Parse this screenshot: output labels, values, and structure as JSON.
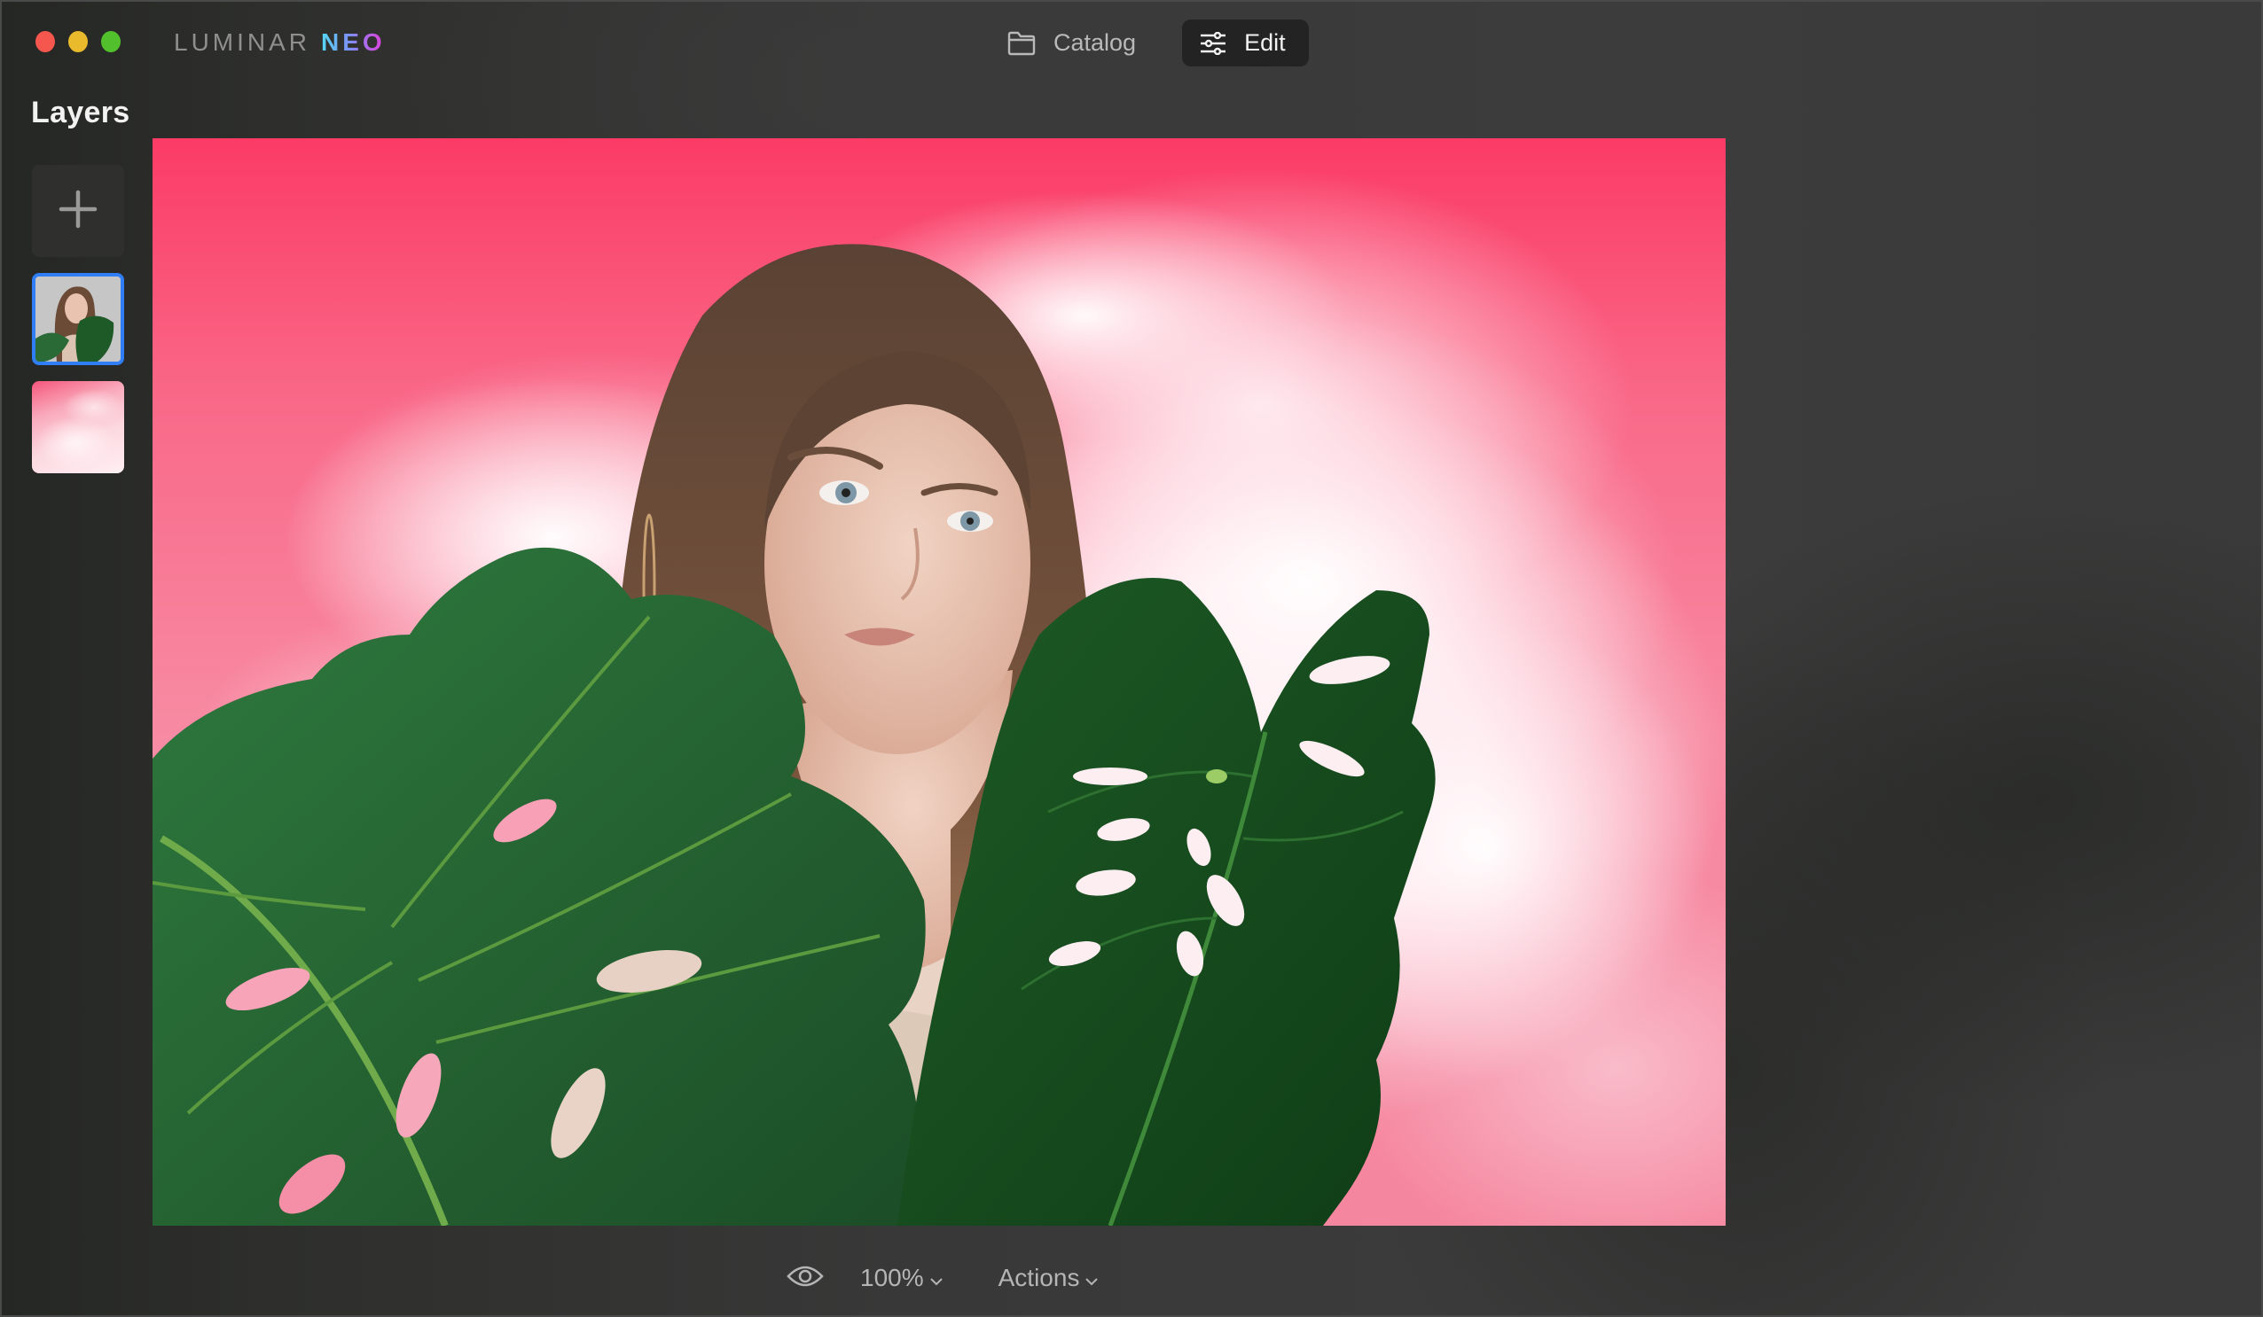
{
  "window": {
    "traffic_lights": [
      "close",
      "minimize",
      "maximize"
    ],
    "logo": {
      "primary": "LUMINAR",
      "secondary": "NEO"
    }
  },
  "topnav": {
    "tabs": [
      {
        "label": "Catalog",
        "icon": "folder-icon",
        "active": false
      },
      {
        "label": "Edit",
        "icon": "sliders-icon",
        "active": true
      }
    ]
  },
  "layers": {
    "title": "Layers",
    "add_icon": "plus-icon",
    "items": [
      {
        "name": "Portrait with monstera leaves",
        "selected": true
      },
      {
        "name": "Pink clouds background",
        "selected": false
      }
    ]
  },
  "canvas": {
    "description": "Composited photo: woman with monstera leaves over pink cloudy sky"
  },
  "bottombar": {
    "preview_icon": "eye-icon",
    "zoom_value": "100%",
    "actions_label": "Actions",
    "chevron": "chevron-down-icon"
  },
  "colors": {
    "accent_selected": "#2f7ef5",
    "close": "#f5574e",
    "minimize": "#e9bb2c",
    "maximize": "#52c02c",
    "background": "#3c3c3c"
  }
}
